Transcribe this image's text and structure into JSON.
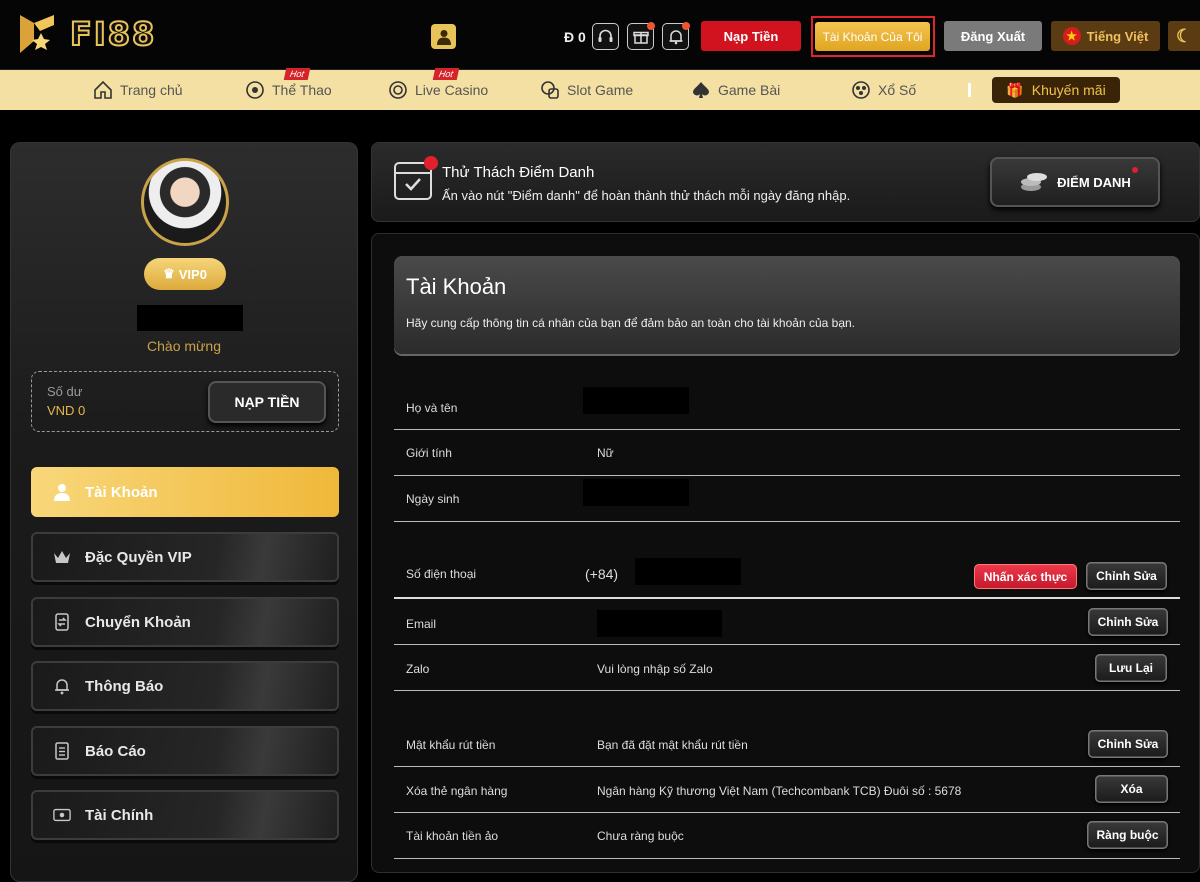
{
  "header": {
    "logo_text": "FI88",
    "balance": "Đ 0",
    "deposit_label": "Nạp Tiền",
    "my_account_label": "Tài Khoản Của Tôi",
    "logout_label": "Đăng Xuất",
    "language_label": "Tiếng Việt",
    "accent_color": "#e8c35a",
    "icons": [
      "user-icon",
      "headset-icon",
      "gift-box-icon",
      "bell-icon",
      "moon-icon"
    ]
  },
  "nav": {
    "items": [
      {
        "label": "Trang chủ",
        "icon": "home-icon"
      },
      {
        "label": "Thể Thao",
        "icon": "soccer-ball-icon",
        "badge": "Hot"
      },
      {
        "label": "Live Casino",
        "icon": "casino-chip-icon",
        "badge": "Hot"
      },
      {
        "label": "Slot Game",
        "icon": "slot-icon"
      },
      {
        "label": "Game Bài",
        "icon": "spade-icon"
      },
      {
        "label": "Xổ Số",
        "icon": "lottery-ball-icon"
      }
    ],
    "promo_label": "Khuyến mãi"
  },
  "sidebar": {
    "vip_label": "VIP0",
    "welcome": "Chào mừng",
    "balance_label": "Số dư",
    "balance_value": "VND 0",
    "deposit_label": "NẠP TIỀN",
    "menu": [
      {
        "label": "Tài Khoản",
        "icon": "user-icon",
        "active": true
      },
      {
        "label": "Đặc Quyền VIP",
        "icon": "crown-icon"
      },
      {
        "label": "Chuyển Khoản",
        "icon": "transfer-icon"
      },
      {
        "label": "Thông Báo",
        "icon": "bell-icon"
      },
      {
        "label": "Báo Cáo",
        "icon": "report-icon"
      },
      {
        "label": "Tài Chính",
        "icon": "wallet-icon"
      }
    ]
  },
  "checkin": {
    "title": "Thử Thách Điểm Danh",
    "subtitle": "Ấn vào nút \"Điểm danh\" để hoàn thành thử thách mỗi ngày đăng nhập.",
    "button_label": "ĐIỂM DANH"
  },
  "account": {
    "title": "Tài Khoản",
    "subtitle": "Hãy cung cấp thông tin cá nhân của bạn để đảm bảo an toàn cho tài khoản của bạn.",
    "rows": [
      {
        "label": "Họ và tên",
        "value": ""
      },
      {
        "label": "Giới tính",
        "value": "Nữ"
      },
      {
        "label": "Ngày sinh",
        "value": ""
      },
      {
        "label": "Số điện thoại",
        "value": "(+84)",
        "verify_label": "Nhấn xác thực",
        "button": "Chỉnh Sửa"
      },
      {
        "label": "Email",
        "value": "",
        "button": "Chỉnh Sửa"
      },
      {
        "label": "Zalo",
        "value": "Vui lòng nhập số Zalo",
        "button": "Lưu Lại"
      },
      {
        "label": "Mật khẩu rút tiền",
        "value": "Bạn đã đặt mật khẩu rút tiền",
        "button": "Chỉnh Sửa"
      },
      {
        "label": "Xóa thẻ ngân hàng",
        "value": "Ngân hàng Kỹ thương Việt Nam (Techcombank TCB) Đuôi số : 5678",
        "button": "Xóa"
      },
      {
        "label": "Tài khoản tiền ảo",
        "value": "Chưa ràng buộc",
        "button": "Ràng buộc"
      }
    ]
  }
}
